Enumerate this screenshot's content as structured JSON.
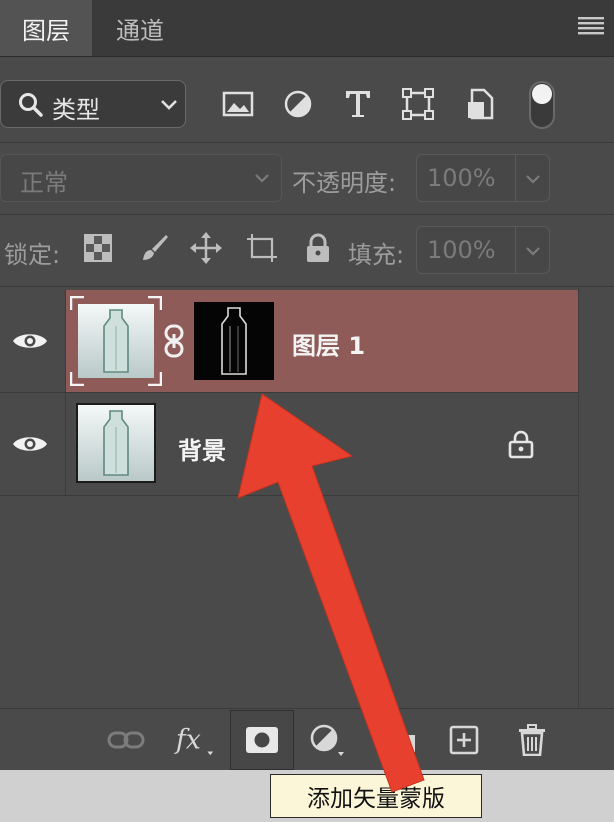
{
  "tabs": [
    {
      "label": "图层",
      "active": true
    },
    {
      "label": "通道",
      "active": false
    }
  ],
  "filter": {
    "label": "类型"
  },
  "blend": {
    "mode": "正常",
    "opacity_label": "不透明度:",
    "opacity_value": "100%"
  },
  "lock": {
    "label": "锁定:",
    "fill_label": "填充:",
    "fill_value": "100%"
  },
  "layers": [
    {
      "name": "图层 1",
      "selected": true,
      "has_vector_mask": true
    },
    {
      "name": "背景",
      "selected": false,
      "locked": true
    }
  ],
  "tooltip": {
    "text": "添加矢量蒙版"
  },
  "colors": {
    "panel_bg": "#4a4a4a",
    "selected_layer": "#8e5b59",
    "annotation_arrow": "#e8402f",
    "tooltip_bg": "#fbf6d8"
  },
  "icons": {
    "tab_menu": "hamburger-icon",
    "filter_tools": [
      "image-filter-icon",
      "adjustment-filter-icon",
      "type-filter-icon",
      "shape-filter-icon",
      "smart-object-filter-icon",
      "filter-toggle-icon"
    ],
    "lock_tools": [
      "lock-transparent-pixels-icon",
      "lock-image-pixels-icon",
      "lock-position-icon",
      "lock-artboard-icon",
      "lock-all-icon"
    ],
    "bottom_tools": [
      "link-layers-icon",
      "fx-icon",
      "add-mask-icon",
      "adjustment-layer-icon",
      "group-folder-icon",
      "new-layer-icon",
      "trash-icon"
    ]
  }
}
